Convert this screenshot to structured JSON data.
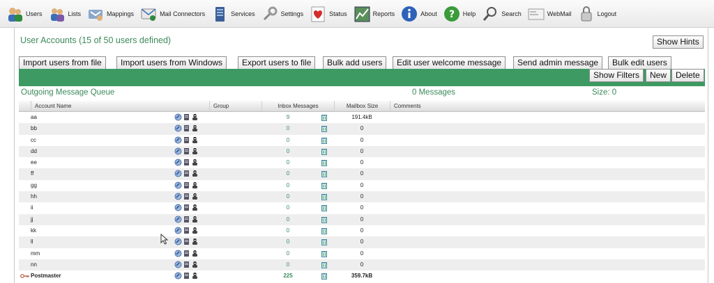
{
  "nav": [
    {
      "label": "Users",
      "icon": "users-icon"
    },
    {
      "label": "Lists",
      "icon": "lists-icon"
    },
    {
      "label": "Mappings",
      "icon": "mappings-icon"
    },
    {
      "label": "Mail Connectors",
      "icon": "mail-connectors-icon"
    },
    {
      "label": "Services",
      "icon": "services-icon"
    },
    {
      "label": "Settings",
      "icon": "settings-icon"
    },
    {
      "label": "Status",
      "icon": "status-icon"
    },
    {
      "label": "Reports",
      "icon": "reports-icon"
    },
    {
      "label": "About",
      "icon": "about-icon"
    },
    {
      "label": "Help",
      "icon": "help-icon"
    },
    {
      "label": "Search",
      "icon": "search-icon"
    },
    {
      "label": "WebMail",
      "icon": "webmail-icon"
    },
    {
      "label": "Logout",
      "icon": "logout-icon"
    }
  ],
  "page": {
    "title": "User Accounts (15 of 50 users defined)",
    "show_hints": "Show Hints"
  },
  "toolbar": {
    "import_file": "Import users from file",
    "import_windows": "Import users from Windows",
    "export_file": "Export users to file",
    "bulk_add": "Bulk add users",
    "edit_welcome": "Edit user welcome message",
    "send_admin": "Send admin message",
    "bulk_edit": "Bulk edit users",
    "show_filters": "Show Filters",
    "new": "New",
    "delete": "Delete"
  },
  "queue": {
    "label": "Outgoing Message Queue",
    "messages": "0 Messages",
    "size": "Size: 0"
  },
  "table": {
    "headers": {
      "account_name": "Account Name",
      "group": "Group",
      "inbox": "Inbox Messages",
      "mailbox": "Mailbox Size",
      "comments": "Comments"
    },
    "rows": [
      {
        "name": "aa",
        "inbox": "9",
        "size": "191.4kB"
      },
      {
        "name": "bb",
        "inbox": "0",
        "size": "0"
      },
      {
        "name": "cc",
        "inbox": "0",
        "size": "0"
      },
      {
        "name": "dd",
        "inbox": "0",
        "size": "0"
      },
      {
        "name": "ee",
        "inbox": "0",
        "size": "0"
      },
      {
        "name": "ff",
        "inbox": "0",
        "size": "0"
      },
      {
        "name": "gg",
        "inbox": "0",
        "size": "0"
      },
      {
        "name": "hh",
        "inbox": "0",
        "size": "0"
      },
      {
        "name": "ii",
        "inbox": "0",
        "size": "0"
      },
      {
        "name": "jj",
        "inbox": "0",
        "size": "0"
      },
      {
        "name": "kk",
        "inbox": "0",
        "size": "0"
      },
      {
        "name": "ll",
        "inbox": "0",
        "size": "0"
      },
      {
        "name": "mm",
        "inbox": "0",
        "size": "0"
      },
      {
        "name": "nn",
        "inbox": "0",
        "size": "0"
      },
      {
        "name": "Postmaster",
        "inbox": "225",
        "size": "359.7kB",
        "bold": true
      }
    ]
  },
  "colors": {
    "accent_green": "#3d9a62",
    "text_green": "#3c8a5a"
  }
}
